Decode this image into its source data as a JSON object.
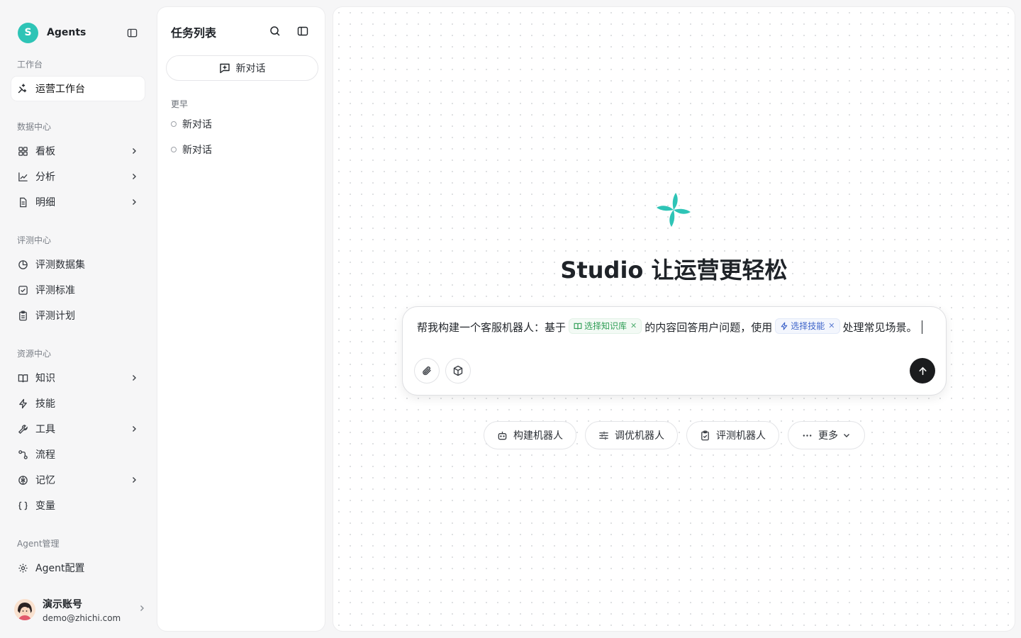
{
  "brand": {
    "logo_letter": "S",
    "name": "Agents"
  },
  "sidebar": {
    "sections": [
      {
        "label": "工作台"
      },
      {
        "label": "数据中心"
      },
      {
        "label": "评测中心"
      },
      {
        "label": "资源中心"
      },
      {
        "label": "Agent管理"
      }
    ],
    "items": [
      {
        "label": "运营工作台",
        "icon": "sparkle-icon",
        "active": true
      },
      {
        "label": "看板",
        "icon": "grid-icon",
        "has_children": true
      },
      {
        "label": "分析",
        "icon": "line-chart-icon",
        "has_children": true
      },
      {
        "label": "明细",
        "icon": "document-icon",
        "has_children": true
      },
      {
        "label": "评测数据集",
        "icon": "pie-chart-icon"
      },
      {
        "label": "评测标准",
        "icon": "checkbox-icon"
      },
      {
        "label": "评测计划",
        "icon": "clipboard-icon"
      },
      {
        "label": "知识",
        "icon": "book-icon",
        "has_children": true
      },
      {
        "label": "技能",
        "icon": "lightning-icon"
      },
      {
        "label": "工具",
        "icon": "wrench-icon",
        "has_children": true
      },
      {
        "label": "流程",
        "icon": "flow-icon"
      },
      {
        "label": "记忆",
        "icon": "brain-icon",
        "has_children": true
      },
      {
        "label": "变量",
        "icon": "braces-icon"
      },
      {
        "label": "Agent配置",
        "icon": "gear-icon"
      }
    ]
  },
  "user": {
    "name": "演示账号",
    "email": "demo@zhichi.com"
  },
  "task_panel": {
    "title": "任务列表",
    "new_chat_label": "新对话",
    "group_label": "更早",
    "chats": [
      {
        "label": "新对话"
      },
      {
        "label": "新对话"
      }
    ]
  },
  "main": {
    "title": "Studio 让运营更轻松",
    "composer": {
      "text_before": "帮我构建一个客服机器人：基于",
      "chip_knowledge": "选择知识库",
      "text_middle": "的内容回答用户问题，使用",
      "chip_skill": "选择技能",
      "text_after": "处理常见场景。"
    },
    "quick_actions": [
      {
        "label": "构建机器人",
        "icon": "robot-icon"
      },
      {
        "label": "调优机器人",
        "icon": "sliders-icon"
      },
      {
        "label": "评测机器人",
        "icon": "clipboard-check-icon"
      },
      {
        "label": "更多",
        "icon": "more-icon"
      }
    ]
  },
  "colors": {
    "accent": "#2ec4b6",
    "send_button": "#1b1c1e",
    "knowledge_chip": "#2f9e56",
    "skill_chip": "#3d63c9"
  }
}
